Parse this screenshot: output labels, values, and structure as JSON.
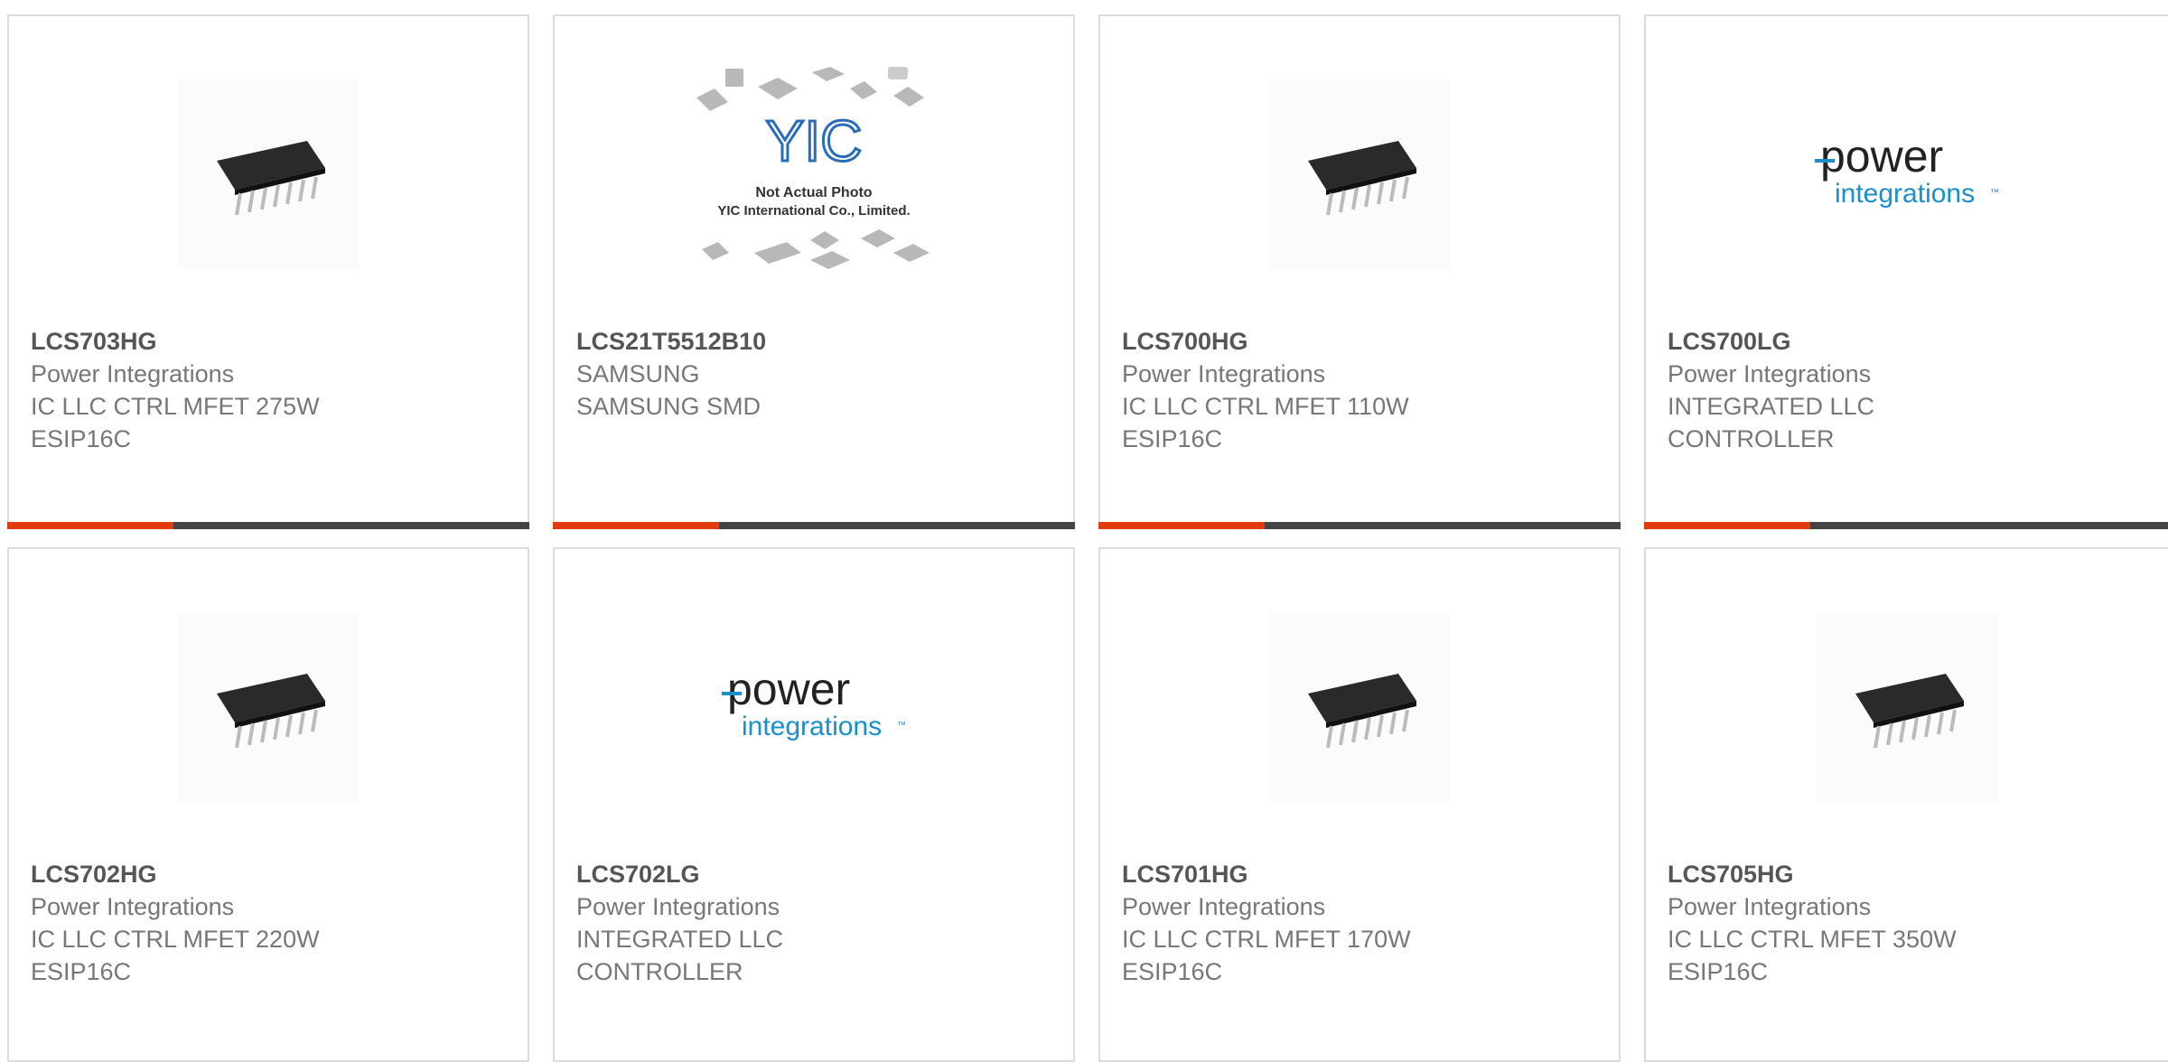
{
  "products": [
    {
      "part": "LCS703HG",
      "brand": "Power Integrations",
      "desc1": "IC LLC CTRL MFET 275W",
      "desc2": "ESIP16C",
      "image": "chip-photo"
    },
    {
      "part": "LCS21T5512B10",
      "brand": "SAMSUNG",
      "desc1": "SAMSUNG SMD",
      "desc2": "",
      "image": "yic-placeholder"
    },
    {
      "part": "LCS700HG",
      "brand": "Power Integrations",
      "desc1": "IC LLC CTRL MFET 110W",
      "desc2": "ESIP16C",
      "image": "chip-photo"
    },
    {
      "part": "LCS700LG",
      "brand": "Power Integrations",
      "desc1": "INTEGRATED LLC",
      "desc2": "CONTROLLER",
      "image": "power-integrations-logo"
    },
    {
      "part": "LCS702HG",
      "brand": "Power Integrations",
      "desc1": "IC LLC CTRL MFET 220W",
      "desc2": "ESIP16C",
      "image": "chip-photo"
    },
    {
      "part": "LCS702LG",
      "brand": "Power Integrations",
      "desc1": "INTEGRATED LLC",
      "desc2": "CONTROLLER",
      "image": "power-integrations-logo"
    },
    {
      "part": "LCS701HG",
      "brand": "Power Integrations",
      "desc1": "IC LLC CTRL MFET 170W",
      "desc2": "ESIP16C",
      "image": "chip-photo"
    },
    {
      "part": "LCS705HG",
      "brand": "Power Integrations",
      "desc1": "IC LLC CTRL MFET 350W",
      "desc2": "ESIP16C",
      "image": "chip-photo"
    }
  ],
  "placeholder": {
    "logo_text": "YIC",
    "line1": "Not Actual Photo",
    "line2": "YIC International Co., Limited."
  },
  "logo": {
    "word1": "power",
    "word2": "integrations",
    "tm": "™"
  },
  "colors": {
    "accent": "#e23c0e",
    "bar_dark": "#444444",
    "brand_blue": "#1a8fc9"
  }
}
